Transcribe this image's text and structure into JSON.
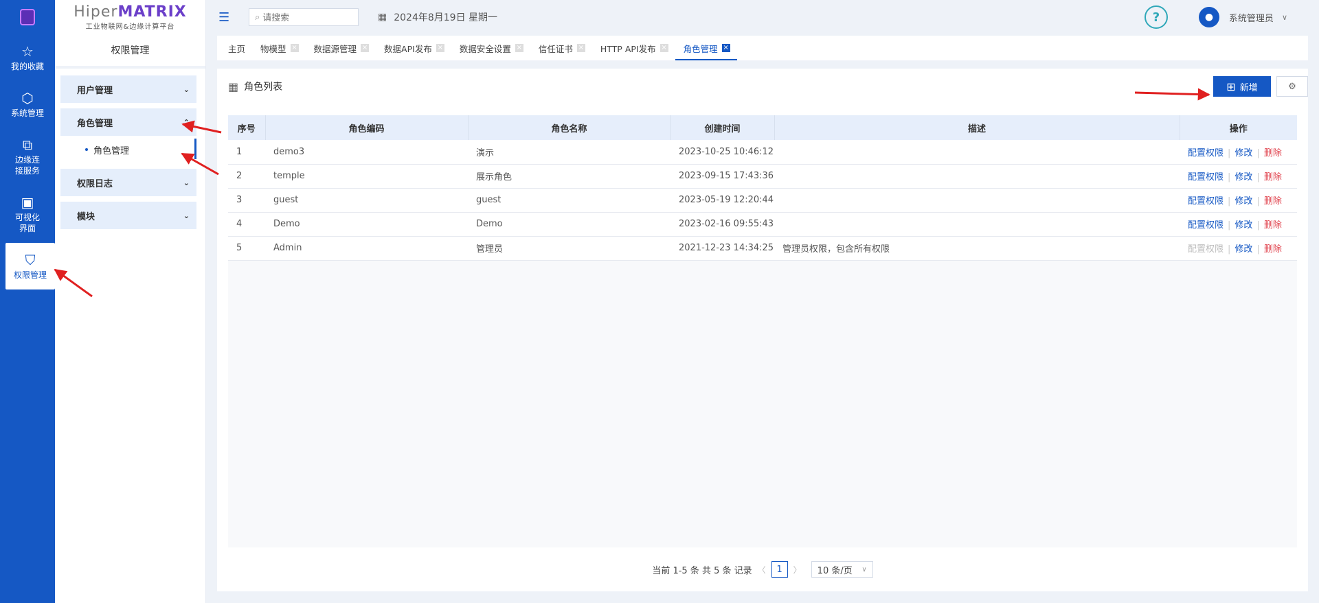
{
  "rail": {
    "items": [
      {
        "label": "我的收藏",
        "icon": "star-icon"
      },
      {
        "label": "系统管理",
        "icon": "cube-icon"
      },
      {
        "label": "边缘连接服务",
        "icon": "link-icon"
      },
      {
        "label": "可视化界面",
        "icon": "monitor-icon"
      },
      {
        "label": "权限管理",
        "icon": "shield-icon"
      }
    ]
  },
  "brand": {
    "name_a": "Hiper",
    "name_b": "MATRIX",
    "subtitle": "工业物联网&边缘计算平台"
  },
  "panel": {
    "title": "权限管理",
    "groups": [
      {
        "label": "用户管理"
      },
      {
        "label": "角色管理"
      },
      {
        "label": "权限日志"
      },
      {
        "label": "模块"
      }
    ],
    "active_sub": "角色管理"
  },
  "header": {
    "search_placeholder": "请搜索",
    "date": "2024年8月19日 星期一",
    "user": "系统管理员"
  },
  "tabs": [
    "主页",
    "物模型",
    "数据源管理",
    "数据API发布",
    "数据安全设置",
    "信任证书",
    "HTTP API发布",
    "角色管理"
  ],
  "card": {
    "title": "角色列表",
    "add_label": "新增",
    "columns": [
      "序号",
      "角色编码",
      "角色名称",
      "创建时间",
      "描述",
      "操作"
    ],
    "rows": [
      {
        "no": "1",
        "code": "demo3",
        "name": "演示",
        "time": "2023-10-25 10:46:12",
        "desc": ""
      },
      {
        "no": "2",
        "code": "temple",
        "name": "展示角色",
        "time": "2023-09-15 17:43:36",
        "desc": ""
      },
      {
        "no": "3",
        "code": "guest",
        "name": "guest",
        "time": "2023-05-19 12:20:44",
        "desc": ""
      },
      {
        "no": "4",
        "code": "Demo",
        "name": "Demo",
        "time": "2023-02-16 09:55:43",
        "desc": ""
      },
      {
        "no": "5",
        "code": "Admin",
        "name": "管理员",
        "time": "2021-12-23 14:34:25",
        "desc": "管理员权限，包含所有权限"
      }
    ],
    "actions": {
      "config": "配置权限",
      "edit": "修改",
      "delete": "删除"
    }
  },
  "pager": {
    "summary": "当前 1-5 条 共 5 条 记录",
    "page": "1",
    "size": "10 条/页"
  },
  "colors": {
    "primary": "#1558c4",
    "danger": "#e0414c",
    "annotation": "#e02020"
  }
}
